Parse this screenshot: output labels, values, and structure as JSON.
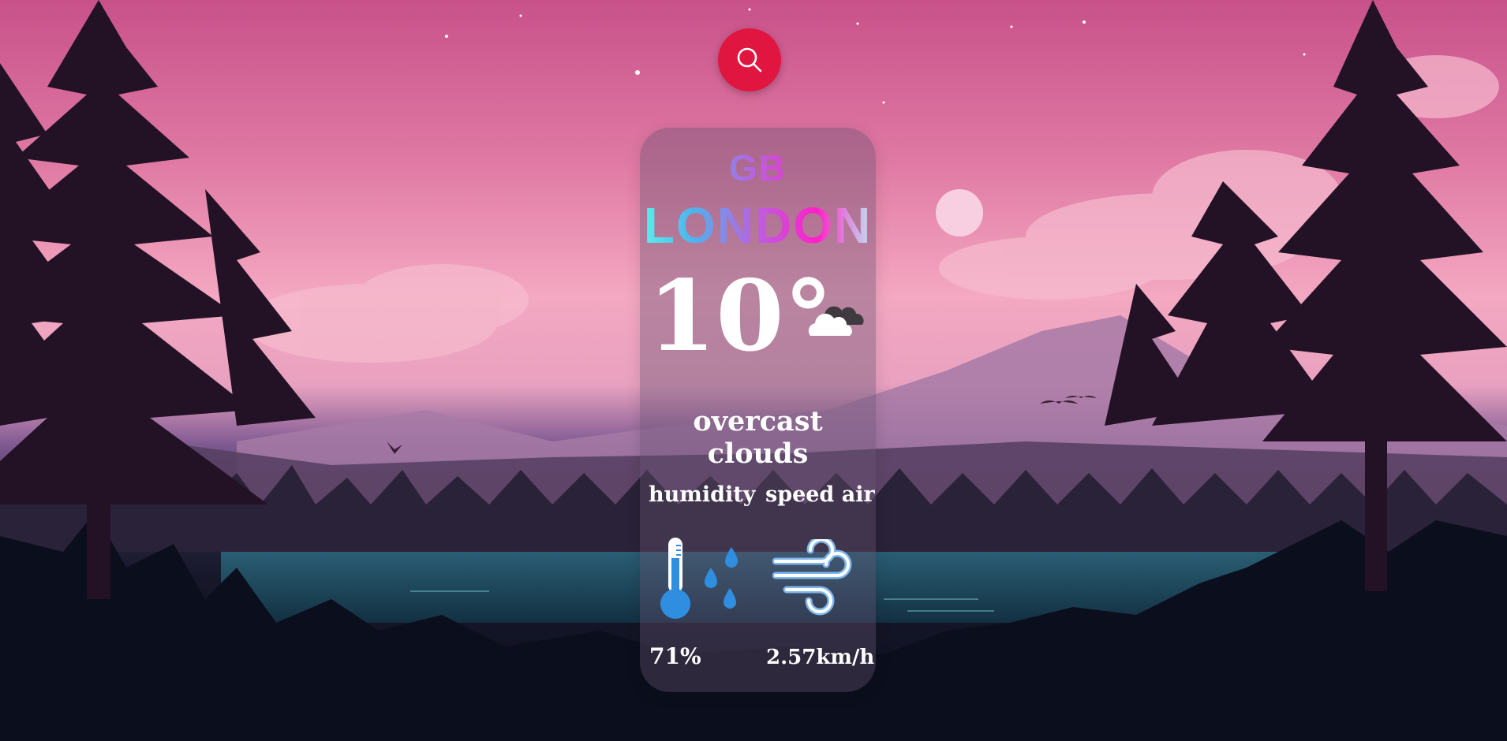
{
  "search": {
    "icon": "search-icon"
  },
  "weather": {
    "country": "GB",
    "city": "LONDON",
    "temperature": "10°",
    "condition_icon": "cloud-icon",
    "description": "overcast clouds",
    "humidity_label": "humidity",
    "wind_label": "speed air",
    "humidity_icon": "thermometer-icon",
    "wind_icon": "wind-icon",
    "humidity_value": "71%",
    "wind_value": "2.57km/h"
  },
  "colors": {
    "search_button": "#e01640",
    "text": "#ffffff",
    "icon_blue": "#2f8ee0"
  }
}
